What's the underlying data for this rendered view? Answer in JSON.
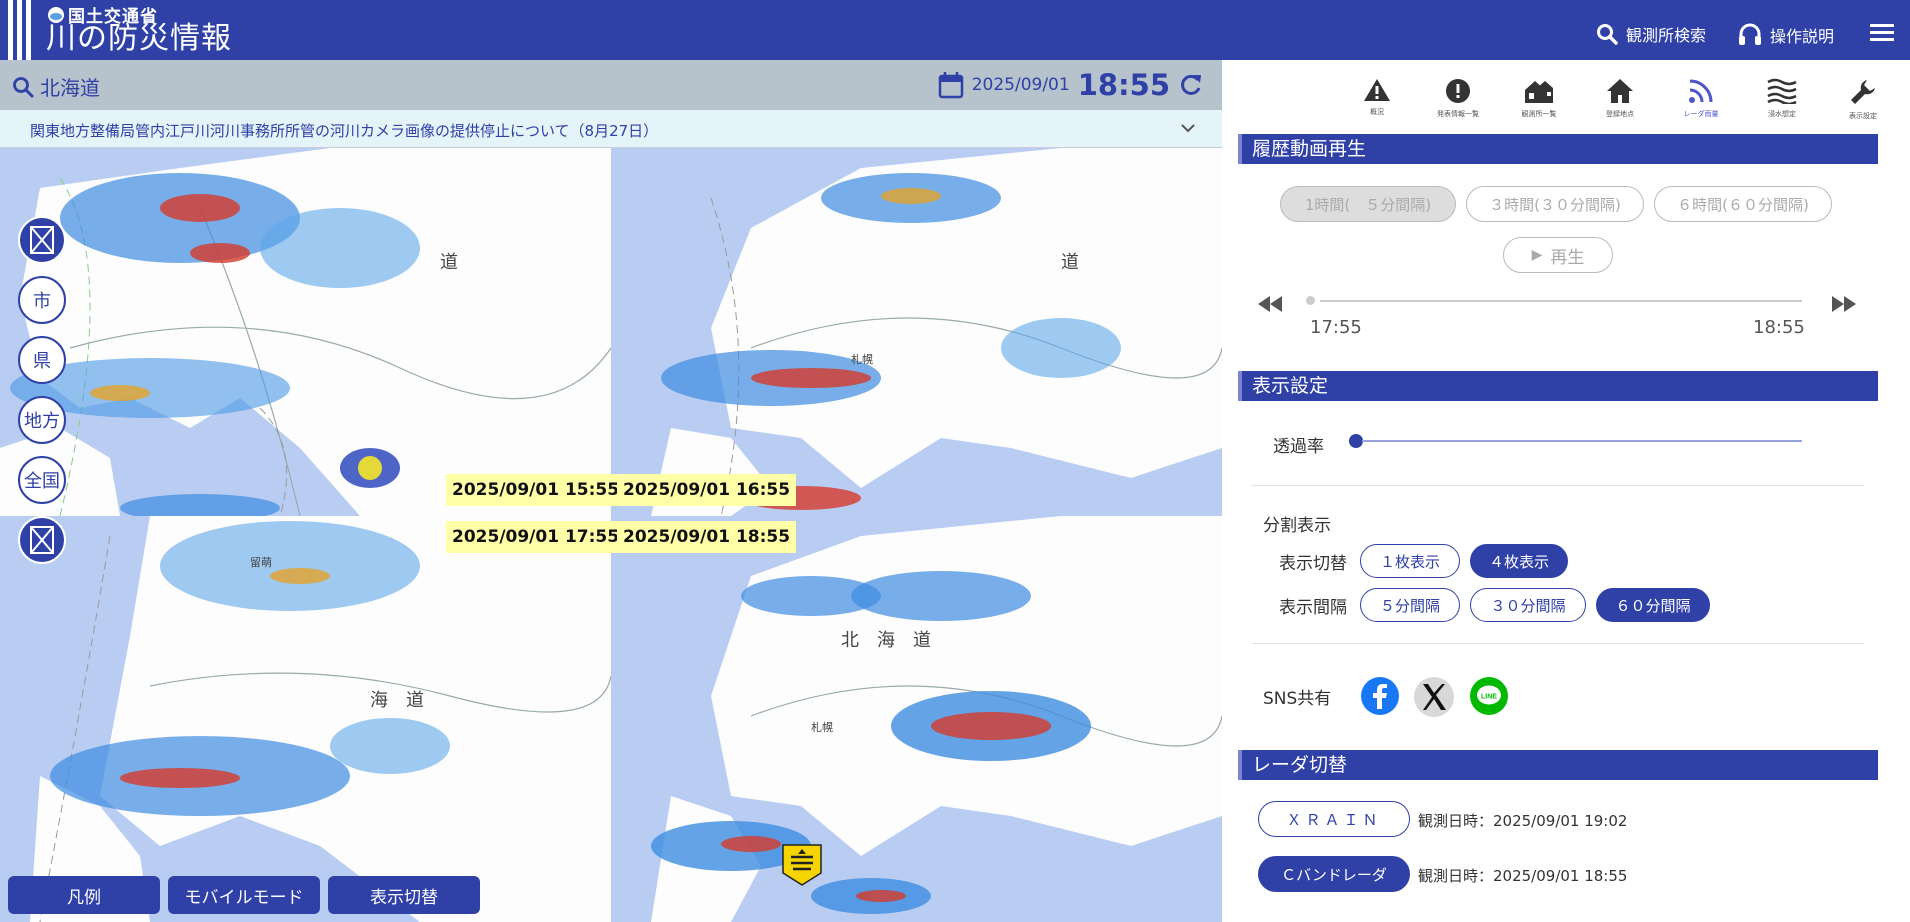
{
  "header": {
    "ministry": "国土交通省",
    "title": "川の防災情報",
    "station_search": "観測所検索",
    "help": "操作説明"
  },
  "search": {
    "location": "北海道"
  },
  "datetime": {
    "date": "2025/09/01",
    "time": "18:55"
  },
  "notice": {
    "text": "関東地方整備局管内江戸川河川事務所所管の河川カメラ画像の提供停止について（8月27日）"
  },
  "map": {
    "timestamps": [
      "2025/09/01 15:55",
      "2025/09/01 16:55",
      "2025/09/01 17:55",
      "2025/09/01 18:55"
    ],
    "scale_buttons": [
      "市",
      "県",
      "地方",
      "全国"
    ],
    "bottom_buttons": {
      "legend": "凡例",
      "mobile": "モバイルモード",
      "display_switch": "表示切替"
    }
  },
  "iconbar": [
    {
      "label": "概況",
      "icon": "warning-icon"
    },
    {
      "label": "発表情報一覧",
      "icon": "alert-circle-icon"
    },
    {
      "label": "観測所一覧",
      "icon": "houses-icon"
    },
    {
      "label": "登録地点",
      "icon": "home-icon"
    },
    {
      "label": "レーダ雨量",
      "icon": "radar-icon",
      "active": true
    },
    {
      "label": "浸水想定",
      "icon": "flood-icon"
    },
    {
      "label": "表示設定",
      "icon": "wrench-icon"
    }
  ],
  "history": {
    "title": "履歴動画再生",
    "options": [
      "1時間(　５分間隔)",
      "３時間(３０分間隔)",
      "６時間(６０分間隔)"
    ],
    "play": "再生",
    "start": "17:55",
    "end": "18:55"
  },
  "display": {
    "title": "表示設定",
    "opacity_label": "透過率",
    "split_label": "分割表示",
    "switch_label": "表示切替",
    "switch_options": [
      "１枚表示",
      "４枚表示"
    ],
    "interval_label": "表示間隔",
    "interval_options": [
      "５分間隔",
      "３０分間隔",
      "６０分間隔"
    ],
    "sns_label": "SNS共有",
    "selected_switch": "４枚表示",
    "selected_interval": "６０分間隔"
  },
  "radar": {
    "title": "レーダ切替",
    "xrain_label": "ＸＲＡＩＮ",
    "xrain_time": "観測日時：2025/09/01 19:02",
    "cband_label": "Ｃバンドレーダ",
    "cband_time": "観測日時：2025/09/01 18:55"
  },
  "colors": {
    "brand": "#2f40a6",
    "sea": "#b9cdf3",
    "stamp": "#ffffa8"
  }
}
